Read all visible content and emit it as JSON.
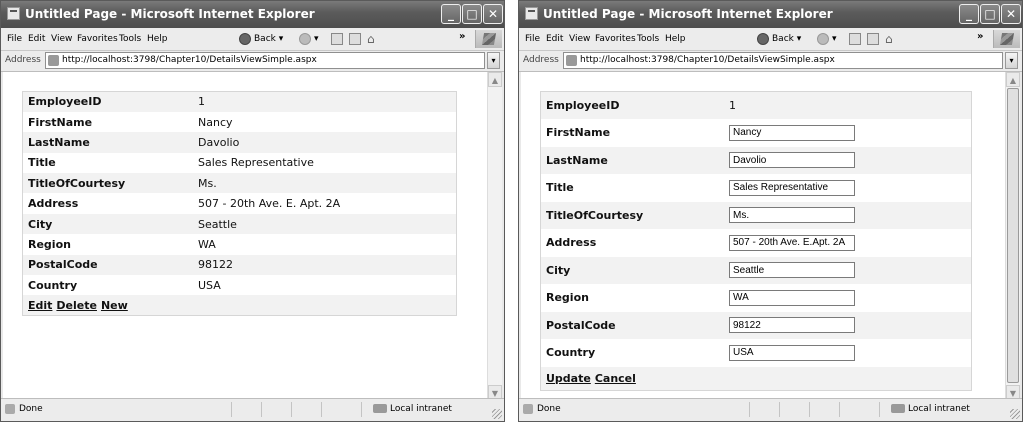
{
  "window_title": "Untitled Page - Microsoft Internet Explorer",
  "menu": [
    "File",
    "Edit",
    "View",
    "Favorites",
    "Tools",
    "Help"
  ],
  "nav": {
    "back": "Back",
    "chevron": "»"
  },
  "address": {
    "label": "Address",
    "url": "http://localhost:3798/Chapter10/DetailsViewSimple.aspx"
  },
  "status": {
    "text": "Done",
    "zone": "Local intranet"
  },
  "fields": [
    {
      "label": "EmployeeID",
      "value": "1"
    },
    {
      "label": "FirstName",
      "value": "Nancy"
    },
    {
      "label": "LastName",
      "value": "Davolio"
    },
    {
      "label": "Title",
      "value": "Sales Representative"
    },
    {
      "label": "TitleOfCourtesy",
      "value": "Ms."
    },
    {
      "label": "Address",
      "value": "507 - 20th Ave. E. Apt. 2A"
    },
    {
      "label": "City",
      "value": "Seattle"
    },
    {
      "label": "Region",
      "value": "WA"
    },
    {
      "label": "PostalCode",
      "value": "98122"
    },
    {
      "label": "Country",
      "value": "USA"
    }
  ],
  "edit_address_value": "507 - 20th Ave. E.Apt. 2A",
  "read_commands": [
    "Edit",
    "Delete",
    "New"
  ],
  "edit_commands": [
    "Update",
    "Cancel"
  ]
}
